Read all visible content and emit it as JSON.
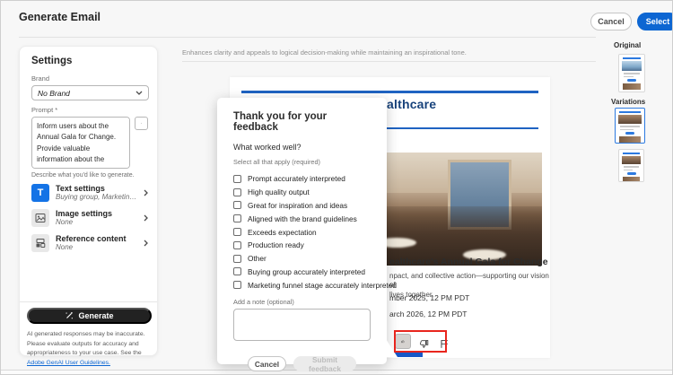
{
  "header": {
    "title": "Generate Email",
    "cancel_label": "Cancel",
    "select_label": "Select"
  },
  "settings_panel": {
    "title": "Settings",
    "brand_label": "Brand",
    "brand_value": "No Brand",
    "prompt_label": "Prompt *",
    "prompt_value": "Inform users about the Annual Gala for Change. Provide valuable information about the value, ensuring clarity and engagement.",
    "prompt_helper": "Describe what you'd like to generate.",
    "items": [
      {
        "label": "Text settings",
        "detail": "Buying group, Marketing journey stage, To..."
      },
      {
        "label": "Image settings",
        "detail": "None"
      },
      {
        "label": "Reference content",
        "detail": "None"
      }
    ],
    "generate_label": "Generate",
    "disclaimer_text": "AI generated responses may be inaccurate. Please evaluate outputs for accuracy and appropriateness to your use case. See the ",
    "disclaimer_link": "Adobe GenAI User Guidelines."
  },
  "toast": {
    "message": "Enhances clarity and appeals to logical decision-making while maintaining an inspirational tone."
  },
  "email_preview": {
    "brand_header_fragment": "althcare",
    "headline_fragment": "ealthcare's Annual Gala for Change",
    "body_line1_fragment": "npact, and collective action—supporting our vision of",
    "body_line2_fragment": "lives together.",
    "date1_fragment": "mber 2025, 12 PM PDT",
    "date2_fragment": "arch 2026, 12 PM PDT"
  },
  "feedback_modal": {
    "title": "Thank you for your feedback",
    "question": "What worked well?",
    "hint": "Select all that apply (required)",
    "options": [
      "Prompt accurately interpreted",
      "High quality output",
      "Great for inspiration and ideas",
      "Aligned with the brand guidelines",
      "Exceeds expectation",
      "Production ready",
      "Other",
      "Buying group accurately interpreted",
      "Marketing funnel stage accurately interpreted"
    ],
    "note_label": "Add a note (optional)",
    "note_value": "",
    "cancel_label": "Cancel",
    "submit_label": "Submit feedback"
  },
  "variations_panel": {
    "original_label": "Original",
    "variations_label": "Variations"
  },
  "colors": {
    "accent_blue": "#0d66d2",
    "email_navy": "#17427b",
    "annotation_red": "#e8251d"
  }
}
